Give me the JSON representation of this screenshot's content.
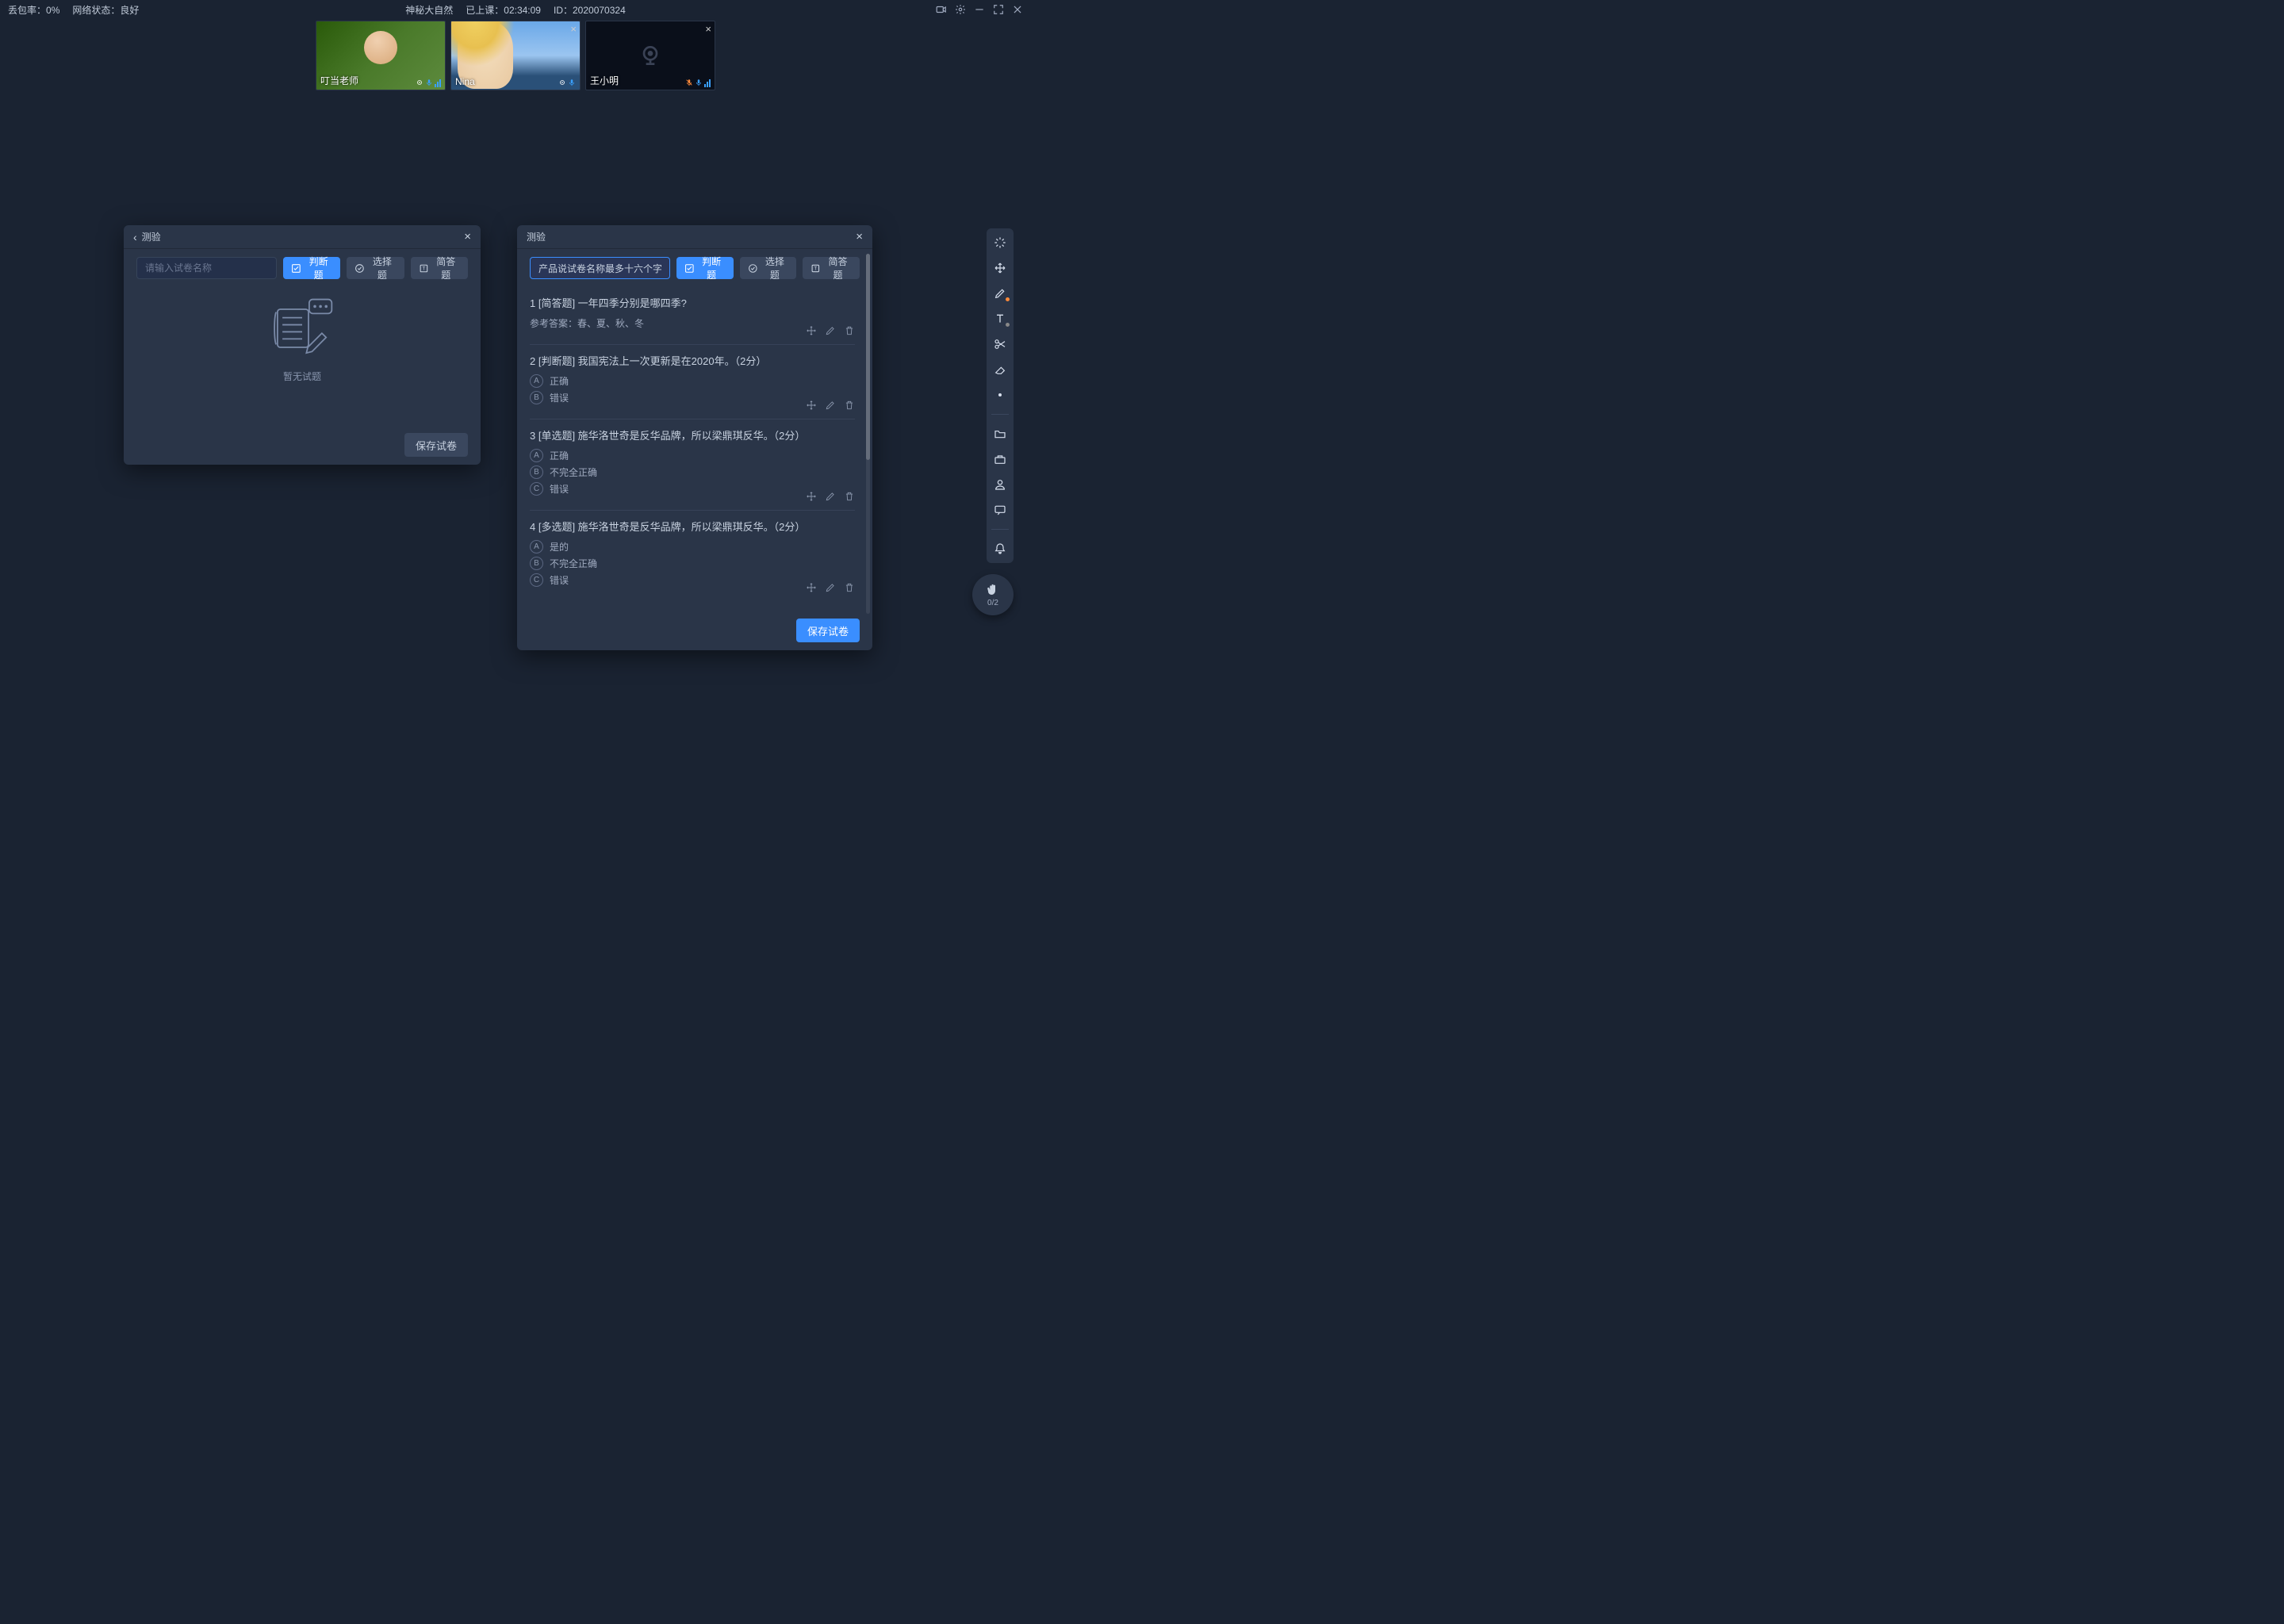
{
  "topbar": {
    "loss_label": "丢包率：",
    "loss_value": "0%",
    "net_label": "网络状态：",
    "net_value": "良好",
    "title": "神秘大自然",
    "elapsed_label": "已上课：",
    "elapsed_value": "02:34:09",
    "id_label": "ID：",
    "id_value": "2020070324"
  },
  "videos": [
    {
      "name": "叮当老师",
      "closable": false,
      "muted": false,
      "type": "green"
    },
    {
      "name": "Nina",
      "closable": true,
      "muted": false,
      "type": "sea"
    },
    {
      "name": "王小明",
      "closable": true,
      "muted": true,
      "type": "dark"
    }
  ],
  "panel_left": {
    "title": "测验",
    "name_placeholder": "请输入试卷名称",
    "btn_judge": "判断题",
    "btn_choice": "选择题",
    "btn_short": "简答题",
    "empty_text": "暂无试题",
    "save_label": "保存试卷"
  },
  "panel_right": {
    "title": "测验",
    "name_value": "产品说试卷名称最多十六个字",
    "btn_judge": "判断题",
    "btn_choice": "选择题",
    "btn_short": "简答题",
    "answer_prefix": "参考答案：",
    "questions": [
      {
        "num": "1",
        "tag": "[简答题]",
        "text": "一年四季分别是哪四季?",
        "answer": "春、夏、秋、冬",
        "opts": []
      },
      {
        "num": "2",
        "tag": "[判断题]",
        "text": "我国宪法上一次更新是在2020年。",
        "score": "（2分）",
        "opts": [
          {
            "l": "A",
            "t": "正确"
          },
          {
            "l": "B",
            "t": "错误"
          }
        ]
      },
      {
        "num": "3",
        "tag": "[单选题]",
        "text": "施华洛世奇是反华品牌，所以梁鼎琪反华。",
        "score": "（2分）",
        "opts": [
          {
            "l": "A",
            "t": "正确"
          },
          {
            "l": "B",
            "t": "不完全正确"
          },
          {
            "l": "C",
            "t": "错误"
          }
        ]
      },
      {
        "num": "4",
        "tag": "[多选题]",
        "text": "施华洛世奇是反华品牌，所以梁鼎琪反华。",
        "score": "（2分）",
        "opts": [
          {
            "l": "A",
            "t": "是的"
          },
          {
            "l": "B",
            "t": "不完全正确"
          },
          {
            "l": "C",
            "t": "错误"
          }
        ]
      }
    ],
    "save_label": "保存试卷"
  },
  "hand": {
    "count": "0/2"
  }
}
